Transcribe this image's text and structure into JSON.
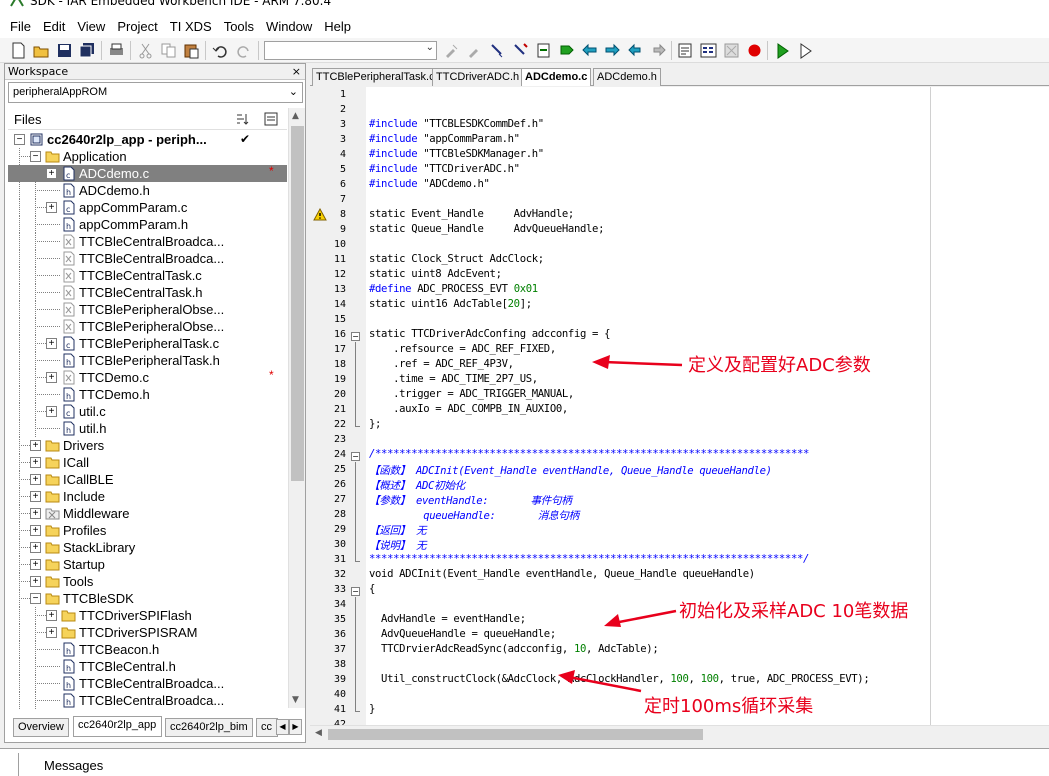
{
  "window": {
    "title": "SDK - IAR Embedded Workbench IDE - ARM 7.80.4"
  },
  "menu": [
    "File",
    "Edit",
    "View",
    "Project",
    "TI XDS",
    "Tools",
    "Window",
    "Help"
  ],
  "workspace": {
    "header": "Workspace",
    "close": "×",
    "config": "peripheralAppROM",
    "files_label": "Files",
    "project": "cc2640r2lp_app - periph...",
    "tree": [
      {
        "label": "cc2640r2lp_app - periph...",
        "type": "project",
        "depth": 0,
        "expander": "−",
        "check": "✔"
      },
      {
        "label": "Application",
        "type": "folder",
        "depth": 1,
        "expander": "−"
      },
      {
        "label": "ADCdemo.c",
        "type": "c",
        "depth": 2,
        "expander": "+",
        "selected": true,
        "modified": "*"
      },
      {
        "label": "ADCdemo.h",
        "type": "h",
        "depth": 2,
        "expander": ""
      },
      {
        "label": "appCommParam.c",
        "type": "c",
        "depth": 2,
        "expander": "+"
      },
      {
        "label": "appCommParam.h",
        "type": "h",
        "depth": 2,
        "expander": ""
      },
      {
        "label": "TTCBleCentralBroadca...",
        "type": "x",
        "depth": 2,
        "expander": ""
      },
      {
        "label": "TTCBleCentralBroadca...",
        "type": "x",
        "depth": 2,
        "expander": ""
      },
      {
        "label": "TTCBleCentralTask.c",
        "type": "x",
        "depth": 2,
        "expander": ""
      },
      {
        "label": "TTCBleCentralTask.h",
        "type": "x",
        "depth": 2,
        "expander": ""
      },
      {
        "label": "TTCBlePeripheralObse...",
        "type": "x",
        "depth": 2,
        "expander": ""
      },
      {
        "label": "TTCBlePeripheralObse...",
        "type": "x",
        "depth": 2,
        "expander": ""
      },
      {
        "label": "TTCBlePeripheralTask.c",
        "type": "c",
        "depth": 2,
        "expander": "+"
      },
      {
        "label": "TTCBlePeripheralTask.h",
        "type": "h",
        "depth": 2,
        "expander": ""
      },
      {
        "label": "TTCDemo.c",
        "type": "x",
        "depth": 2,
        "expander": "+",
        "modified": "*"
      },
      {
        "label": "TTCDemo.h",
        "type": "h",
        "depth": 2,
        "expander": ""
      },
      {
        "label": "util.c",
        "type": "c",
        "depth": 2,
        "expander": "+"
      },
      {
        "label": "util.h",
        "type": "h",
        "depth": 2,
        "expander": ""
      },
      {
        "label": "Drivers",
        "type": "folder",
        "depth": 1,
        "expander": "+"
      },
      {
        "label": "ICall",
        "type": "folder",
        "depth": 1,
        "expander": "+"
      },
      {
        "label": "ICallBLE",
        "type": "folder",
        "depth": 1,
        "expander": "+"
      },
      {
        "label": "Include",
        "type": "folder",
        "depth": 1,
        "expander": "+"
      },
      {
        "label": "Middleware",
        "type": "xfolder",
        "depth": 1,
        "expander": "+"
      },
      {
        "label": "Profiles",
        "type": "folder",
        "depth": 1,
        "expander": "+"
      },
      {
        "label": "StackLibrary",
        "type": "folder",
        "depth": 1,
        "expander": "+"
      },
      {
        "label": "Startup",
        "type": "folder",
        "depth": 1,
        "expander": "+"
      },
      {
        "label": "Tools",
        "type": "folder",
        "depth": 1,
        "expander": "+"
      },
      {
        "label": "TTCBleSDK",
        "type": "folder",
        "depth": 1,
        "expander": "−"
      },
      {
        "label": "TTCDriverSPIFlash",
        "type": "folder",
        "depth": 2,
        "expander": "+"
      },
      {
        "label": "TTCDriverSPISRAM",
        "type": "folder",
        "depth": 2,
        "expander": "+"
      },
      {
        "label": "TTCBeacon.h",
        "type": "h",
        "depth": 2,
        "expander": ""
      },
      {
        "label": "TTCBleCentral.h",
        "type": "h",
        "depth": 2,
        "expander": ""
      },
      {
        "label": "TTCBleCentralBroadca...",
        "type": "h",
        "depth": 2,
        "expander": ""
      },
      {
        "label": "TTCBleCentralBroadca...",
        "type": "h",
        "depth": 2,
        "expander": ""
      }
    ],
    "tabs": [
      "Overview",
      "cc2640r2lp_app",
      "cc2640r2lp_bim",
      "cc"
    ]
  },
  "editor": {
    "tabs": [
      "TTCBlePeripheralTask.c",
      "TTCDriverADC.h",
      "ADCdemo.c",
      "ADCdemo.h"
    ],
    "active_tab": 2,
    "lines": [
      {
        "n": "1",
        "html": ""
      },
      {
        "n": "2",
        "html": ""
      },
      {
        "n": "3",
        "html": "<span class='pp'>#include</span> \"TTCBLESDKCommDef.h\""
      },
      {
        "n": "3",
        "html": "<span class='pp'>#include</span> \"appCommParam.h\""
      },
      {
        "n": "4",
        "html": "<span class='pp'>#include</span> \"TTCBleSDKManager.h\""
      },
      {
        "n": "5",
        "html": "<span class='pp'>#include</span> \"TTCDriverADC.h\""
      },
      {
        "n": "6",
        "html": "<span class='pp'>#include</span> \"ADCdemo.h\""
      },
      {
        "n": "7",
        "html": ""
      },
      {
        "n": "8",
        "html": "static Event_Handle     AdvHandle;"
      },
      {
        "n": "9",
        "html": "static Queue_Handle     AdvQueueHandle;"
      },
      {
        "n": "10",
        "html": ""
      },
      {
        "n": "11",
        "html": "static Clock_Struct AdcClock;"
      },
      {
        "n": "12",
        "html": "static uint8 AdcEvent;"
      },
      {
        "n": "13",
        "html": "<span class='pp'>#define</span> ADC_PROCESS_EVT <span class='num'>0x01</span>"
      },
      {
        "n": "14",
        "html": "static uint16 AdcTable[<span class='num'>20</span>];"
      },
      {
        "n": "15",
        "html": ""
      },
      {
        "n": "16",
        "html": "static TTCDriverAdcConfing adcconfig = {"
      },
      {
        "n": "17",
        "html": "    .refsource = ADC_REF_FIXED,"
      },
      {
        "n": "18",
        "html": "    .ref = ADC_REF_4P3V,"
      },
      {
        "n": "19",
        "html": "    .time = ADC_TIME_2P7_US,"
      },
      {
        "n": "20",
        "html": "    .trigger = ADC_TRIGGER_MANUAL,"
      },
      {
        "n": "21",
        "html": "    .auxIo = ADC_COMPB_IN_AUXIO0,"
      },
      {
        "n": "22",
        "html": "};"
      },
      {
        "n": "23",
        "html": ""
      },
      {
        "n": "24",
        "html": "<span class='cm'>/************************************************************************</span>"
      },
      {
        "n": "25",
        "html": "<span class='cm'>【函数】 ADCInit(Event_Handle eventHandle, Queue_Handle queueHandle)</span>"
      },
      {
        "n": "26",
        "html": "<span class='cm'>【概述】 ADC初始化</span>"
      },
      {
        "n": "27",
        "html": "<span class='cm'>【参数】 eventHandle:       事件句柄</span>"
      },
      {
        "n": "28",
        "html": "<span class='cm'>         queueHandle:       消息句柄</span>"
      },
      {
        "n": "29",
        "html": "<span class='cm'>【返回】 无</span>"
      },
      {
        "n": "30",
        "html": "<span class='cm'>【说明】 无</span>"
      },
      {
        "n": "31",
        "html": "<span class='cm'>************************************************************************/</span>"
      },
      {
        "n": "32",
        "html": "void ADCInit(Event_Handle eventHandle, Queue_Handle queueHandle)"
      },
      {
        "n": "33",
        "html": "{"
      },
      {
        "n": "34",
        "html": ""
      },
      {
        "n": "35",
        "html": "  AdvHandle = eventHandle;"
      },
      {
        "n": "36",
        "html": "  AdvQueueHandle = queueHandle;"
      },
      {
        "n": "37",
        "html": "  TTCDrvierAdcReadSync(adcconfig, <span class='num'>10</span>, AdcTable);"
      },
      {
        "n": "38",
        "html": ""
      },
      {
        "n": "39",
        "html": "  Util_constructClock(&amp;AdcClock, AdcClockHandler, <span class='num'>100</span>, <span class='num'>100</span>, true, ADC_PROCESS_EVT);"
      },
      {
        "n": "40",
        "html": ""
      },
      {
        "n": "41",
        "html": "}"
      },
      {
        "n": "42",
        "html": ""
      }
    ]
  },
  "annotations": {
    "config": "定义及配置好ADC参数",
    "init": "初始化及采样ADC 10笔数据",
    "timer": "定时100ms循环采集"
  },
  "messages": {
    "label": "Messages"
  }
}
